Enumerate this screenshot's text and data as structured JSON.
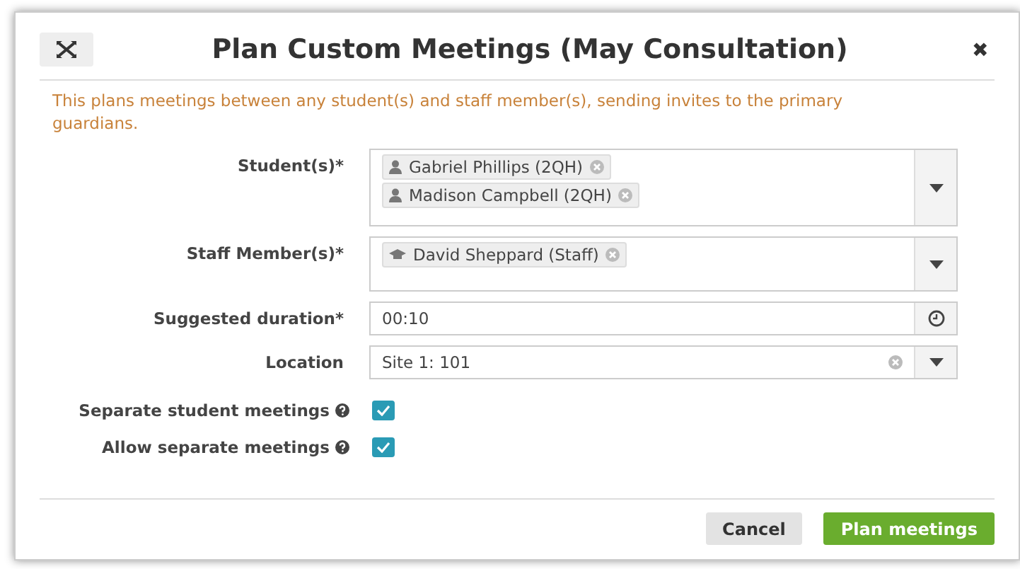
{
  "dialog": {
    "title": "Plan Custom Meetings (May Consultation)",
    "close": "✖"
  },
  "intro": "This plans meetings between any student(s) and staff member(s), sending invites to the primary guardians.",
  "fields": [
    {
      "kind": "multiselect",
      "label": "Student(s)*",
      "tags": [
        {
          "kind": "person",
          "text": "Gabriel Phillips (2QH)"
        },
        {
          "kind": "person",
          "text": "Madison Campbell (2QH)"
        }
      ]
    },
    {
      "kind": "multiselect",
      "label": "Staff Member(s)*",
      "tags": [
        {
          "kind": "staff",
          "text": "David Sheppard (Staff)"
        }
      ]
    },
    {
      "kind": "time",
      "label": "Suggested duration*",
      "value": "00:10"
    },
    {
      "kind": "select",
      "label": "Location",
      "value": "Site 1: 101"
    }
  ],
  "options": [
    {
      "label": "Separate student meetings",
      "checked": true
    },
    {
      "label": "Allow separate meetings",
      "checked": true
    }
  ],
  "buttons": [
    {
      "kind": "secondary",
      "label": "Cancel"
    },
    {
      "kind": "primary",
      "label": "Plan meetings"
    }
  ]
}
